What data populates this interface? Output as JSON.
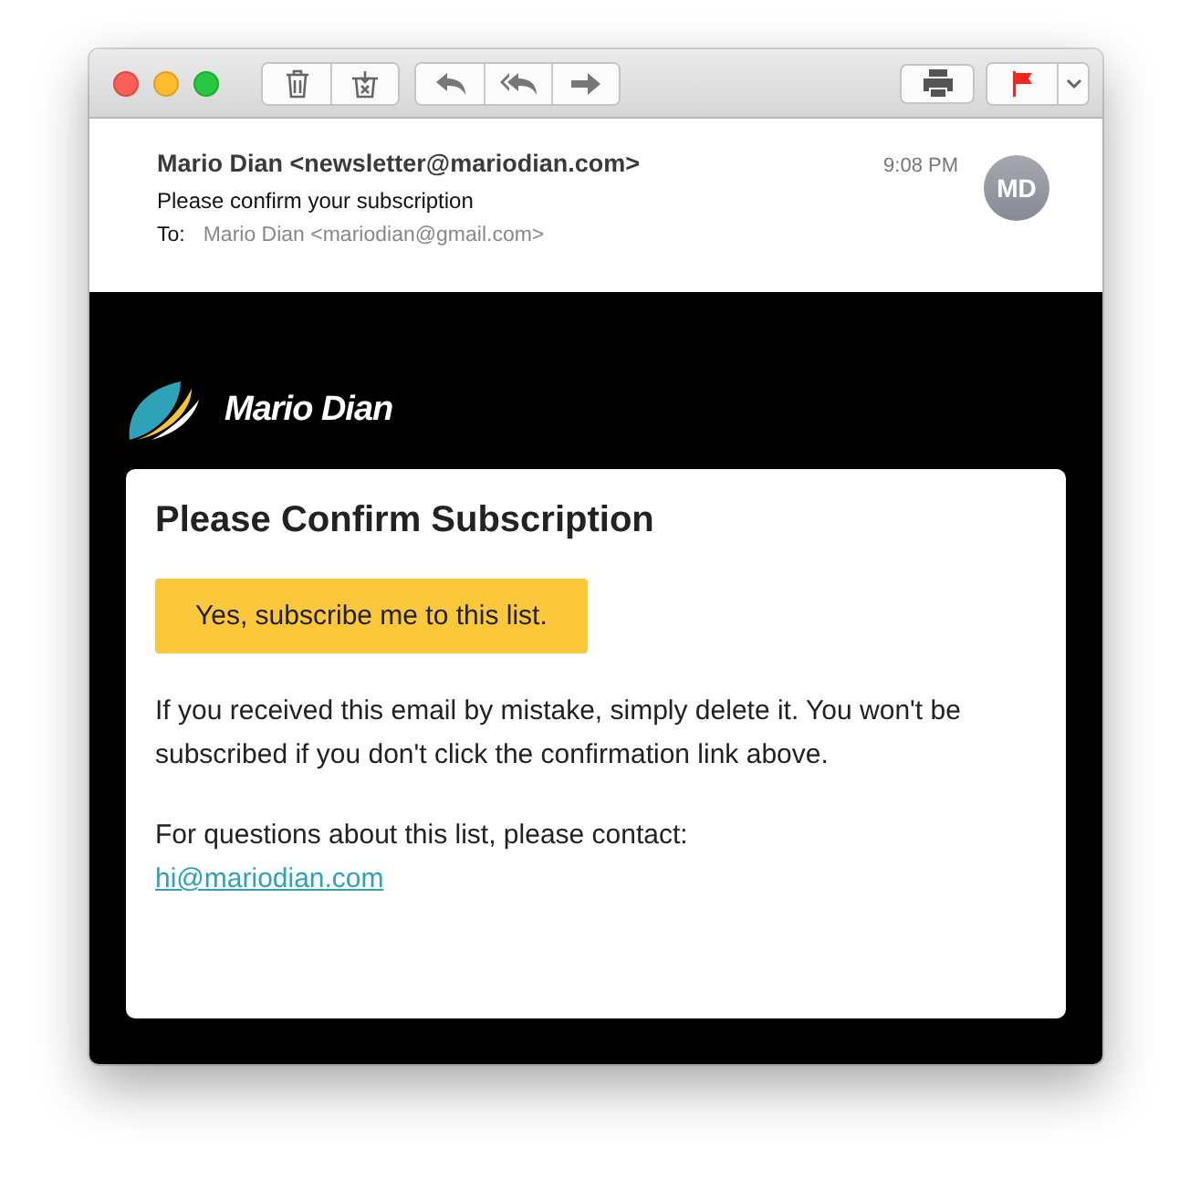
{
  "message": {
    "from": "Mario Dian <newsletter@mariodian.com>",
    "time": "9:08 PM",
    "avatar": "MD",
    "subject": "Please confirm your subscription",
    "to_label": "To:",
    "to": "Mario Dian <mariodian@gmail.com>"
  },
  "email": {
    "brand": "Mario Dian",
    "heading": "Please Confirm Subscription",
    "button": "Yes, subscribe me to this list.",
    "body": "If you received this email by mistake, simply delete it. You won't be subscribed if you don't click the confirmation link above.",
    "contact": "For questions about this list, please contact:",
    "link": "hi@mariodian.com"
  }
}
